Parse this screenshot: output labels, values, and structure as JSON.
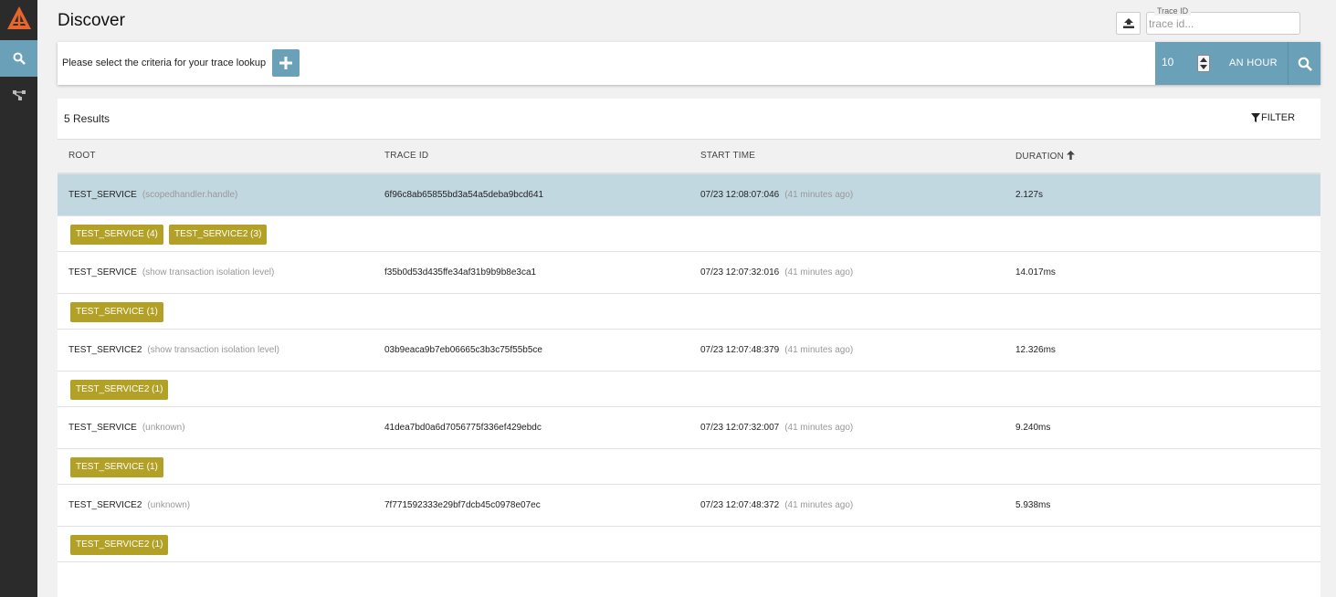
{
  "header": {
    "title": "Discover",
    "trace_id_legend": "Trace ID",
    "trace_id_placeholder": "trace id..."
  },
  "criteria": {
    "prompt": "Please select the criteria for your trace lookup",
    "limit": "10",
    "lookback": "AN HOUR"
  },
  "results": {
    "count_label": "5 Results",
    "filter_label": "FILTER",
    "columns": {
      "root": "ROOT",
      "trace_id": "TRACE ID",
      "start_time": "START TIME",
      "duration": "DURATION"
    },
    "rows": [
      {
        "service": "TEST_SERVICE",
        "span": "(scopedhandler.handle)",
        "trace_id": "6f96c8ab65855bd3a54a5deba9bcd641",
        "start": "07/23 12:08:07:046",
        "ago": "(41 minutes ago)",
        "duration": "2.127s",
        "badges": [
          "TEST_SERVICE (4)",
          "TEST_SERVICE2 (3)"
        ]
      },
      {
        "service": "TEST_SERVICE",
        "span": "(show transaction isolation level)",
        "trace_id": "f35b0d53d435ffe34af31b9b9b8e3ca1",
        "start": "07/23 12:07:32:016",
        "ago": "(41 minutes ago)",
        "duration": "14.017ms",
        "badges": [
          "TEST_SERVICE (1)"
        ]
      },
      {
        "service": "TEST_SERVICE2",
        "span": "(show transaction isolation level)",
        "trace_id": "03b9eaca9b7eb06665c3b3c75f55b5ce",
        "start": "07/23 12:07:48:379",
        "ago": "(41 minutes ago)",
        "duration": "12.326ms",
        "badges": [
          "TEST_SERVICE2 (1)"
        ]
      },
      {
        "service": "TEST_SERVICE",
        "span": "(unknown)",
        "trace_id": "41dea7bd0a6d7056775f336ef429ebdc",
        "start": "07/23 12:07:32:007",
        "ago": "(41 minutes ago)",
        "duration": "9.240ms",
        "badges": [
          "TEST_SERVICE (1)"
        ]
      },
      {
        "service": "TEST_SERVICE2",
        "span": "(unknown)",
        "trace_id": "7f771592333e29bf7dcb45c0978e07ec",
        "start": "07/23 12:07:48:372",
        "ago": "(41 minutes ago)",
        "duration": "5.938ms",
        "badges": [
          "TEST_SERVICE2 (1)"
        ]
      }
    ]
  },
  "colors": {
    "accent": "#6aa1b9",
    "badge": "#b3a026",
    "selected_row": "#c2d8e1",
    "sidebar": "#2b2b2b"
  }
}
